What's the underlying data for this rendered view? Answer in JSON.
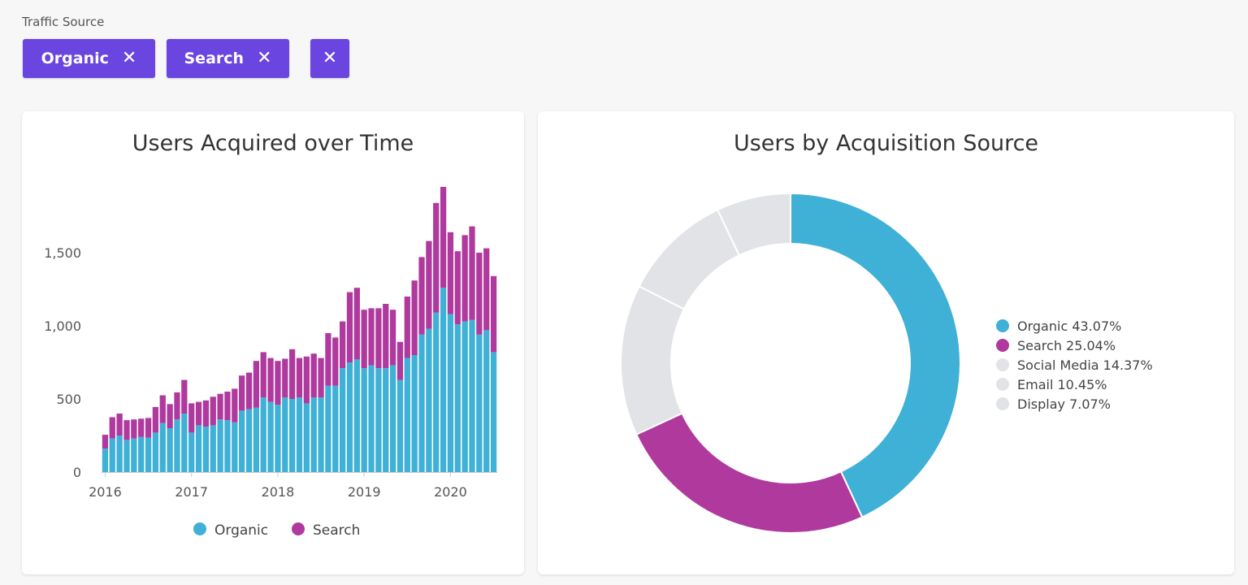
{
  "filter": {
    "label": "Traffic Source",
    "chips": [
      {
        "label": "Organic",
        "remove_icon": "close-icon"
      },
      {
        "label": "Search",
        "remove_icon": "close-icon"
      }
    ],
    "clear_icon": "close-icon"
  },
  "colors": {
    "accent": "#6a45e0",
    "organic": "#3fb0d6",
    "search": "#b0399e",
    "other": "#e2e3e6"
  },
  "bar_chart": {
    "title": "Users Acquired over Time",
    "chart_data": {
      "type": "bar",
      "stacked": true,
      "x_ticks": [
        "2016",
        "2017",
        "2018",
        "2019",
        "2020"
      ],
      "y_ticks": [
        "0",
        "500",
        "1,000",
        "1,500"
      ],
      "ylim": [
        0,
        2000
      ],
      "legend_position": "bottom",
      "series": [
        {
          "name": "Organic",
          "color": "#3fb0d6",
          "values": [
            160,
            230,
            250,
            220,
            230,
            240,
            235,
            270,
            335,
            300,
            360,
            400,
            270,
            320,
            310,
            320,
            360,
            355,
            340,
            420,
            430,
            440,
            510,
            480,
            460,
            510,
            500,
            510,
            470,
            510,
            510,
            590,
            590,
            710,
            750,
            770,
            710,
            730,
            710,
            710,
            730,
            630,
            780,
            800,
            940,
            980,
            1090,
            1260,
            1080,
            1010,
            1030,
            1040,
            940,
            970,
            820
          ]
        },
        {
          "name": "Search",
          "color": "#b0399e",
          "values": [
            95,
            145,
            150,
            135,
            130,
            125,
            135,
            175,
            190,
            165,
            185,
            230,
            200,
            160,
            180,
            195,
            175,
            195,
            230,
            240,
            250,
            320,
            310,
            300,
            300,
            265,
            340,
            270,
            320,
            300,
            270,
            360,
            330,
            320,
            480,
            490,
            400,
            390,
            410,
            440,
            380,
            260,
            420,
            510,
            530,
            600,
            750,
            690,
            560,
            500,
            590,
            640,
            560,
            560,
            520
          ]
        }
      ]
    }
  },
  "donut_chart": {
    "title": "Users by Acquisition Source",
    "chart_data": {
      "type": "pie",
      "donut": true,
      "legend_position": "right",
      "slices": [
        {
          "name": "Organic",
          "value": 43.07,
          "label": "Organic 43.07%",
          "color": "#3fb0d6"
        },
        {
          "name": "Search",
          "value": 25.04,
          "label": "Search 25.04%",
          "color": "#b0399e"
        },
        {
          "name": "Social Media",
          "value": 14.37,
          "label": "Social Media 14.37%",
          "color": "#e2e3e6"
        },
        {
          "name": "Email",
          "value": 10.45,
          "label": "Email 10.45%",
          "color": "#e2e3e6"
        },
        {
          "name": "Display",
          "value": 7.07,
          "label": "Display 7.07%",
          "color": "#e2e3e6"
        }
      ]
    }
  }
}
